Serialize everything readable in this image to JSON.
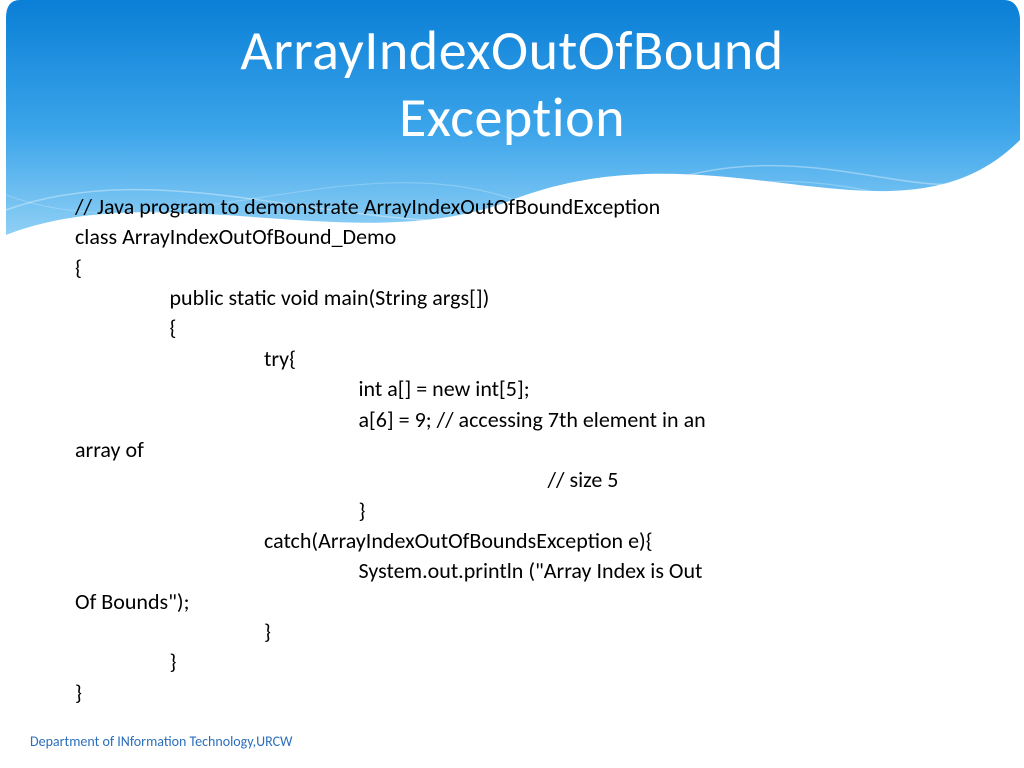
{
  "title_line1": "ArrayIndexOutOfBound",
  "title_line2": "Exception",
  "code": {
    "l01": "// Java program to demonstrate ArrayIndexOutOfBoundException",
    "l02": "class ArrayIndexOutOfBound_Demo",
    "l03": "{",
    "l04": "                   public static void main(String args[])",
    "l05": "                   {",
    "l06": "                                      try{",
    "l07": "                                                         int a[] = new int[5];",
    "l08": "                                                         a[6] = 9; // accessing 7th element in an",
    "l08b": "array of",
    "l09": "                                                                                               // size 5",
    "l10": "                                                         }",
    "l11": "                                      catch(ArrayIndexOutOfBoundsException e){",
    "l12": "                                                         System.out.println (\"Array Index is Out",
    "l12b": "Of Bounds\");",
    "l13": "                                      }",
    "l14": "                   }",
    "l15": "}"
  },
  "footer": "Department of INformation Technology,URCW"
}
